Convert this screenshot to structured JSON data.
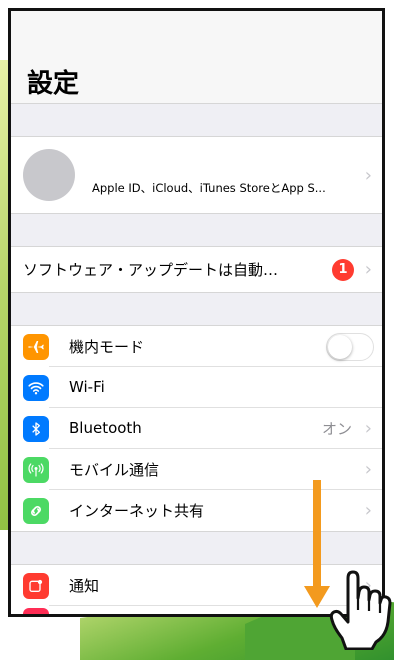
{
  "header": {
    "title": "設定"
  },
  "profile": {
    "subtitle": "Apple ID、iCloud、iTunes StoreとApp S..."
  },
  "update": {
    "label": "ソフトウェア・アップデートは自動…",
    "badge": "1"
  },
  "settings": {
    "items": [
      {
        "label": "機内モード",
        "icon": "airplane-icon",
        "color": "#ff9500"
      },
      {
        "label": "Wi-Fi",
        "icon": "wifi-icon",
        "color": "#007aff"
      },
      {
        "label": "Bluetooth",
        "icon": "bluetooth-icon",
        "color": "#007aff",
        "value": "オン"
      },
      {
        "label": "モバイル通信",
        "icon": "cellular-icon",
        "color": "#4cd964"
      },
      {
        "label": "インターネット共有",
        "icon": "hotspot-icon",
        "color": "#4cd964"
      }
    ]
  },
  "notifications": {
    "label": "通知",
    "icon": "notifications-icon",
    "color": "#ff3b30"
  },
  "overlay": {
    "arrow_color": "#f39a1e",
    "gesture": "swipe-down-hand-icon"
  }
}
